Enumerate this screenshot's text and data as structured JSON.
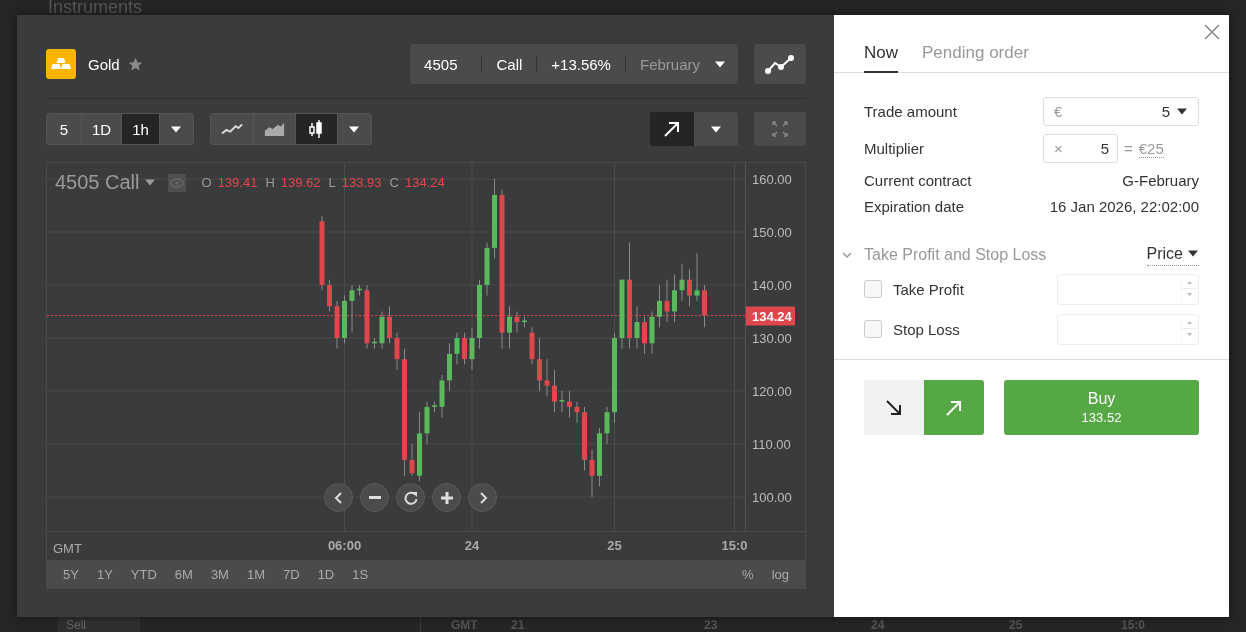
{
  "background": {
    "title": "Instruments",
    "sell_button": "Sell",
    "axis_labels": [
      "GMT",
      "21",
      "23",
      "24",
      "25",
      "15:0"
    ]
  },
  "instrument": {
    "name": "Gold",
    "favorite": false
  },
  "contract_bar": {
    "strike": "4505",
    "type": "Call",
    "change": "+13.56%",
    "month": "February"
  },
  "intervals": [
    {
      "label": "5",
      "selected": false
    },
    {
      "label": "1D",
      "selected": false
    },
    {
      "label": "1h",
      "selected": true
    }
  ],
  "chart_types": [
    {
      "kind": "line",
      "selected": false
    },
    {
      "kind": "area",
      "selected": false
    },
    {
      "kind": "candles",
      "selected": true
    }
  ],
  "chart": {
    "series_label": "4505 Call",
    "ohlc": [
      {
        "key": "O",
        "value": "139.41"
      },
      {
        "key": "H",
        "value": "139.62"
      },
      {
        "key": "L",
        "value": "133.93"
      },
      {
        "key": "C",
        "value": "134.24"
      }
    ],
    "time_zone": "GMT",
    "chart_data": {
      "type": "candlestick",
      "categories": [
        null,
        null,
        null,
        "06:00",
        null,
        null,
        null,
        null,
        null,
        null,
        null,
        null,
        null,
        null,
        null,
        null,
        null,
        null,
        null,
        null,
        "24",
        null,
        null,
        null,
        null,
        null,
        null,
        null,
        null,
        null,
        null,
        null,
        null,
        null,
        null,
        null,
        null,
        null,
        null,
        "25",
        null,
        null,
        null,
        null,
        null,
        null,
        null,
        null,
        null,
        null,
        null,
        null,
        null,
        null,
        null,
        "15:0"
      ],
      "ohlc": [
        [
          152,
          153,
          139,
          140
        ],
        [
          140,
          141,
          135,
          136
        ],
        [
          136,
          137,
          128,
          130
        ],
        [
          130,
          138,
          129,
          137
        ],
        [
          137,
          140,
          131,
          139
        ],
        [
          139,
          140,
          138,
          139.3
        ],
        [
          139,
          140,
          128,
          129
        ],
        [
          129,
          130,
          128,
          129.3
        ],
        [
          129,
          135,
          128,
          134
        ],
        [
          134,
          136,
          129,
          130
        ],
        [
          130,
          131,
          124,
          126
        ],
        [
          126,
          128,
          104,
          107
        ],
        [
          107,
          110,
          104,
          104.5
        ],
        [
          104,
          116,
          103,
          112
        ],
        [
          112,
          118,
          110,
          117
        ],
        [
          117,
          118,
          116,
          117.3
        ],
        [
          117,
          123,
          115,
          122
        ],
        [
          122,
          129,
          120,
          127
        ],
        [
          127,
          131,
          125,
          130
        ],
        [
          130,
          131,
          125,
          126
        ],
        [
          126,
          132,
          124,
          130
        ],
        [
          130,
          141,
          128,
          140
        ],
        [
          140,
          148,
          138,
          147
        ],
        [
          147,
          160,
          145,
          157
        ],
        [
          157,
          158,
          128,
          131
        ],
        [
          131,
          136,
          128,
          134
        ],
        [
          134,
          135,
          131,
          133
        ],
        [
          133,
          134,
          132,
          133.3
        ],
        [
          131,
          132,
          125,
          126
        ],
        [
          126,
          130,
          120,
          122
        ],
        [
          122,
          126,
          119,
          121
        ],
        [
          121,
          124,
          116,
          118
        ],
        [
          118,
          120,
          116,
          118.3
        ],
        [
          118,
          120,
          115,
          117
        ],
        [
          117,
          118,
          114,
          116
        ],
        [
          116,
          117,
          105,
          107
        ],
        [
          107,
          109,
          100,
          104
        ],
        [
          104,
          113,
          102,
          112
        ],
        [
          112,
          117,
          110,
          116
        ],
        [
          116,
          131,
          114,
          130
        ],
        [
          130,
          141,
          128,
          141
        ],
        [
          141,
          148,
          128,
          130
        ],
        [
          130,
          136,
          128,
          133
        ],
        [
          133,
          134,
          127,
          129
        ],
        [
          129,
          135,
          127,
          134
        ],
        [
          134,
          140,
          132,
          137
        ],
        [
          137,
          141,
          133,
          135
        ],
        [
          135,
          142,
          133,
          139
        ],
        [
          139,
          144,
          137,
          141
        ],
        [
          141,
          143,
          136,
          138
        ],
        [
          138,
          146,
          137,
          139
        ],
        [
          139,
          140,
          132,
          134.24
        ],
        null,
        null,
        null,
        null
      ],
      "grid": true,
      "ylim": [
        93.58,
        163.02
      ],
      "yticks": [
        {
          "value": 160,
          "label": "160.00"
        },
        {
          "value": 150,
          "label": "150.00"
        },
        {
          "value": 140,
          "label": "140.00"
        },
        {
          "value": 130,
          "label": "130.00"
        },
        {
          "value": 120,
          "label": "120.00"
        },
        {
          "value": 110,
          "label": "110.00"
        },
        {
          "value": 100,
          "label": "100.00"
        }
      ],
      "ref_lines": [
        {
          "axis": "y",
          "value": 134.24,
          "label": "134.24"
        }
      ]
    }
  },
  "ranges": [
    "5Y",
    "1Y",
    "YTD",
    "6M",
    "3M",
    "1M",
    "7D",
    "1D",
    "1S"
  ],
  "scale_options": [
    "%",
    "log"
  ],
  "order": {
    "tabs": [
      {
        "label": "Now",
        "selected": true
      },
      {
        "label": "Pending order",
        "selected": false
      }
    ],
    "trade_amount": {
      "label": "Trade amount",
      "currency": "€",
      "value": "5"
    },
    "multiplier": {
      "label": "Multiplier",
      "symbol": "×",
      "value": "5",
      "equals": "=",
      "total": "€25"
    },
    "details": [
      {
        "label": "Current contract",
        "value": "G-February"
      },
      {
        "label": "Expiration date",
        "value": "16 Jan 2026, 22:02:00"
      }
    ],
    "tp_sl": {
      "title": "Take Profit and Stop Loss",
      "expanded": true,
      "mode": "Price",
      "rows": [
        {
          "label": "Take Profit",
          "checked": false
        },
        {
          "label": "Stop Loss",
          "checked": false
        }
      ]
    },
    "direction": [
      {
        "kind": "down",
        "selected": false
      },
      {
        "kind": "up",
        "selected": true
      }
    ],
    "buy": {
      "label": "Buy",
      "price": "133.52"
    }
  }
}
